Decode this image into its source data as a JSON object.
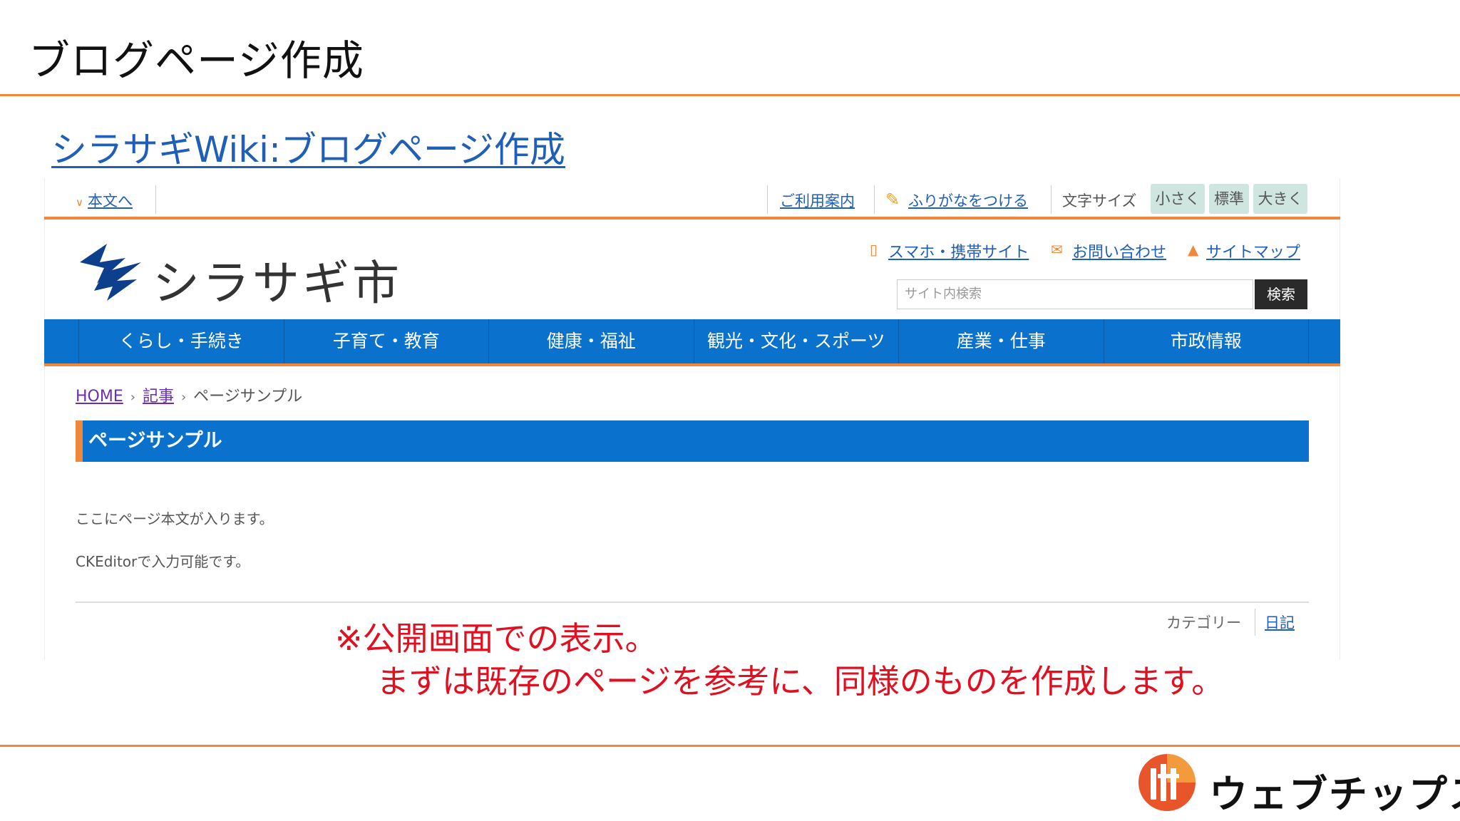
{
  "slide": {
    "title": "ブログページ作成",
    "link_text": "シラサギWiki:ブログページ作成",
    "note_line1": "※公開画面での表示。",
    "note_line2": "まずは既存のページを参考に、同様のものを作成します。",
    "company_name": "ウェブチップス",
    "accent_color": "#f0883c",
    "note_color": "#e01020"
  },
  "site": {
    "utility": {
      "skip_label": "本文へ",
      "guide_label": "ご利用案内",
      "furigana_label": "ふりがなをつける",
      "font_size_label": "文字サイズ",
      "font_small": "小さく",
      "font_standard": "標準",
      "font_large": "大きく"
    },
    "header": {
      "logo_text": "シラサギ市",
      "mobile_label": "スマホ・携帯サイト",
      "contact_label": "お問い合わせ",
      "sitemap_label": "サイトマップ",
      "search_placeholder": "サイト内検索",
      "search_button": "検索"
    },
    "global_nav": [
      "くらし・手続き",
      "子育て・教育",
      "健康・福祉",
      "観光・文化・スポーツ",
      "産業・仕事",
      "市政情報"
    ],
    "breadcrumb": {
      "home": "HOME",
      "articles": "記事",
      "current": "ページサンプル"
    },
    "page": {
      "heading": "ページサンプル",
      "paragraph1": "ここにページ本文が入ります。",
      "paragraph2": "CKEditorで入力可能です。",
      "category_label": "カテゴリー",
      "category_link": "日記"
    },
    "nav_color": "#0a71cc"
  }
}
